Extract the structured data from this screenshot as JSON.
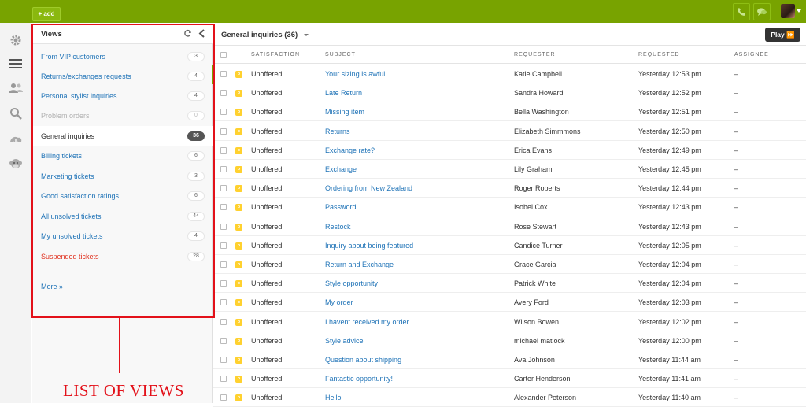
{
  "topbar": {
    "add_label": "+ add",
    "icons": [
      "phone-icon",
      "chat-icon",
      "avatar",
      "chevron-down-icon"
    ]
  },
  "leftnav": {
    "icons": [
      "settings-icon",
      "views-menu-icon",
      "users-icon",
      "search-icon",
      "reporting-icon",
      "monkey-icon"
    ]
  },
  "views": {
    "title": "Views",
    "items": [
      {
        "label": "From VIP customers",
        "count": "3",
        "state": "normal"
      },
      {
        "label": "Returns/exchanges requests",
        "count": "4",
        "state": "normal"
      },
      {
        "label": "Personal stylist inquiries",
        "count": "4",
        "state": "normal"
      },
      {
        "label": "Problem orders",
        "count": "0",
        "state": "muted"
      },
      {
        "label": "General inquiries",
        "count": "36",
        "state": "selected"
      },
      {
        "label": "Billing tickets",
        "count": "6",
        "state": "normal"
      },
      {
        "label": "Marketing tickets",
        "count": "3",
        "state": "normal"
      },
      {
        "label": "Good satisfaction ratings",
        "count": "6",
        "state": "normal"
      },
      {
        "label": "All unsolved tickets",
        "count": "44",
        "state": "normal"
      },
      {
        "label": "My unsolved tickets",
        "count": "4",
        "state": "normal"
      },
      {
        "label": "Suspended tickets",
        "count": "28",
        "state": "red"
      }
    ],
    "more_label": "More »"
  },
  "annotation": {
    "text": "LIST OF VIEWS"
  },
  "main": {
    "title": "General inquiries (36)",
    "play_label": "Play ⏩",
    "columns": [
      "Satisfaction",
      "Subject",
      "Requester",
      "Requested",
      "Assignee"
    ],
    "rows": [
      {
        "status": "o",
        "satisfaction": "Unoffered",
        "subject": "Your sizing is awful",
        "requester": "Katie Campbell",
        "requested": "Yesterday 12:53 pm",
        "assignee": "–"
      },
      {
        "status": "o",
        "satisfaction": "Unoffered",
        "subject": "Late Return",
        "requester": "Sandra Howard",
        "requested": "Yesterday 12:52 pm",
        "assignee": "–"
      },
      {
        "status": "o",
        "satisfaction": "Unoffered",
        "subject": "Missing item",
        "requester": "Bella Washington",
        "requested": "Yesterday 12:51 pm",
        "assignee": "–"
      },
      {
        "status": "o",
        "satisfaction": "Unoffered",
        "subject": "Returns",
        "requester": "Elizabeth Simmmons",
        "requested": "Yesterday 12:50 pm",
        "assignee": "–"
      },
      {
        "status": "o",
        "satisfaction": "Unoffered",
        "subject": "Exchange rate?",
        "requester": "Erica Evans",
        "requested": "Yesterday 12:49 pm",
        "assignee": "–"
      },
      {
        "status": "o",
        "satisfaction": "Unoffered",
        "subject": "Exchange",
        "requester": "Lily Graham",
        "requested": "Yesterday 12:45 pm",
        "assignee": "–"
      },
      {
        "status": "o",
        "satisfaction": "Unoffered",
        "subject": "Ordering from New Zealand",
        "requester": "Roger Roberts",
        "requested": "Yesterday 12:44 pm",
        "assignee": "–"
      },
      {
        "status": "o",
        "satisfaction": "Unoffered",
        "subject": "Password",
        "requester": "Isobel Cox",
        "requested": "Yesterday 12:43 pm",
        "assignee": "–"
      },
      {
        "status": "o",
        "satisfaction": "Unoffered",
        "subject": "Restock",
        "requester": "Rose Stewart",
        "requested": "Yesterday 12:43 pm",
        "assignee": "–"
      },
      {
        "status": "o",
        "satisfaction": "Unoffered",
        "subject": "Inquiry about being featured",
        "requester": "Candice Turner",
        "requested": "Yesterday 12:05 pm",
        "assignee": "–"
      },
      {
        "status": "o",
        "satisfaction": "Unoffered",
        "subject": "Return and Exchange",
        "requester": "Grace Garcia",
        "requested": "Yesterday 12:04 pm",
        "assignee": "–"
      },
      {
        "status": "o",
        "satisfaction": "Unoffered",
        "subject": "Style opportunity",
        "requester": "Patrick White",
        "requested": "Yesterday 12:04 pm",
        "assignee": "–"
      },
      {
        "status": "o",
        "satisfaction": "Unoffered",
        "subject": "My order",
        "requester": "Avery Ford",
        "requested": "Yesterday 12:03 pm",
        "assignee": "–"
      },
      {
        "status": "o",
        "satisfaction": "Unoffered",
        "subject": "I havent received my order",
        "requester": "Wilson Bowen",
        "requested": "Yesterday 12:02 pm",
        "assignee": "–"
      },
      {
        "status": "o",
        "satisfaction": "Unoffered",
        "subject": "Style advice",
        "requester": "michael matlock",
        "requested": "Yesterday 12:00 pm",
        "assignee": "–"
      },
      {
        "status": "o",
        "satisfaction": "Unoffered",
        "subject": "Question about shipping",
        "requester": "Ava Johnson",
        "requested": "Yesterday 11:44 am",
        "assignee": "–"
      },
      {
        "status": "o",
        "satisfaction": "Unoffered",
        "subject": "Fantastic opportunity!",
        "requester": "Carter Henderson",
        "requested": "Yesterday 11:41 am",
        "assignee": "–"
      },
      {
        "status": "o",
        "satisfaction": "Unoffered",
        "subject": "Hello",
        "requester": "Alexander Peterson",
        "requested": "Yesterday 11:40 am",
        "assignee": "–"
      }
    ]
  },
  "colors": {
    "topbar": "#78a300",
    "link": "#1f73b7",
    "status_open": "#ffd12f",
    "annotation": "#e3111a",
    "suspended": "#e0301e"
  }
}
